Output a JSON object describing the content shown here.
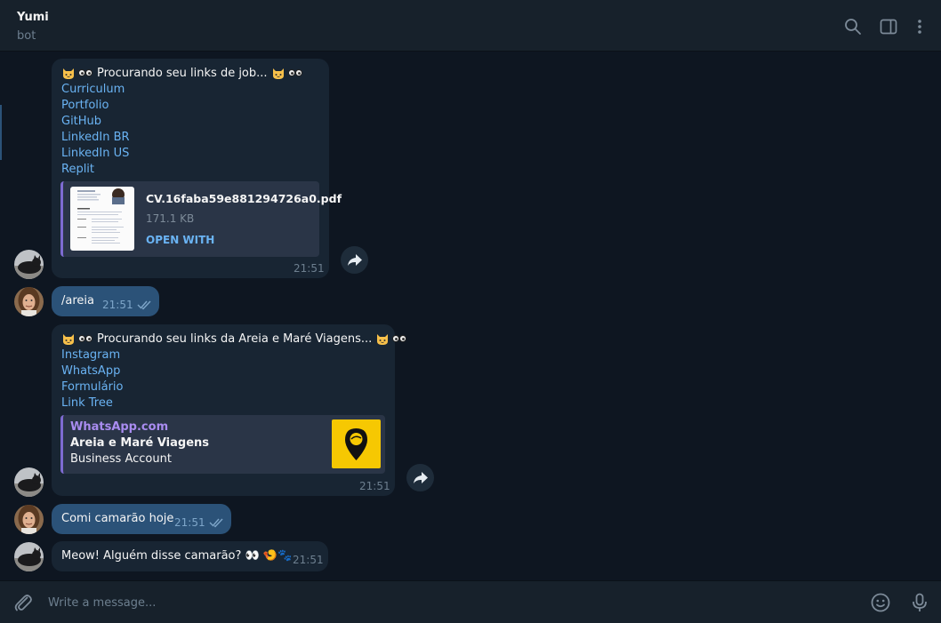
{
  "header": {
    "title": "Yumi",
    "status": "bot"
  },
  "messages": {
    "msg1": {
      "heading": "Procurando seu links de job...",
      "links": [
        "Curriculum",
        "Portfolio",
        "GitHub",
        "LinkedIn BR",
        "LinkedIn US",
        "Replit"
      ],
      "document": {
        "name": "CV.16faba59e881294726a0.pdf",
        "size": "171.1 KB",
        "action": "OPEN WITH"
      },
      "time": "21:51"
    },
    "msg2": {
      "text": "/areia",
      "time": "21:51"
    },
    "msg3": {
      "heading": "Procurando seu links da Areia e Maré Viagens...",
      "links": [
        "Instagram",
        "WhatsApp",
        "Formulário",
        "Link Tree"
      ],
      "preview": {
        "site": "WhatsApp.com",
        "title": "Areia e Maré Viagens",
        "description": "Business Account"
      },
      "time": "21:51"
    },
    "msg4": {
      "text": "Comi camarão hoje",
      "time": "21:51"
    },
    "msg5": {
      "text": "Meow! Alguém disse camarão? 👀 🍤🐾",
      "time": "21:51"
    }
  },
  "composer": {
    "placeholder": "Write a message..."
  },
  "colors": {
    "background": "#0e1621",
    "panel": "#17212b",
    "incoming": "#182533",
    "outgoing": "#2b5278",
    "link": "#6ab3f3",
    "accent_bar": "#7e6bd2"
  },
  "icons": [
    "search-icon",
    "sidebar-toggle-icon",
    "more-vertical-icon",
    "forward-icon",
    "attach-icon",
    "emoji-icon",
    "microphone-icon",
    "double-check-icon"
  ]
}
